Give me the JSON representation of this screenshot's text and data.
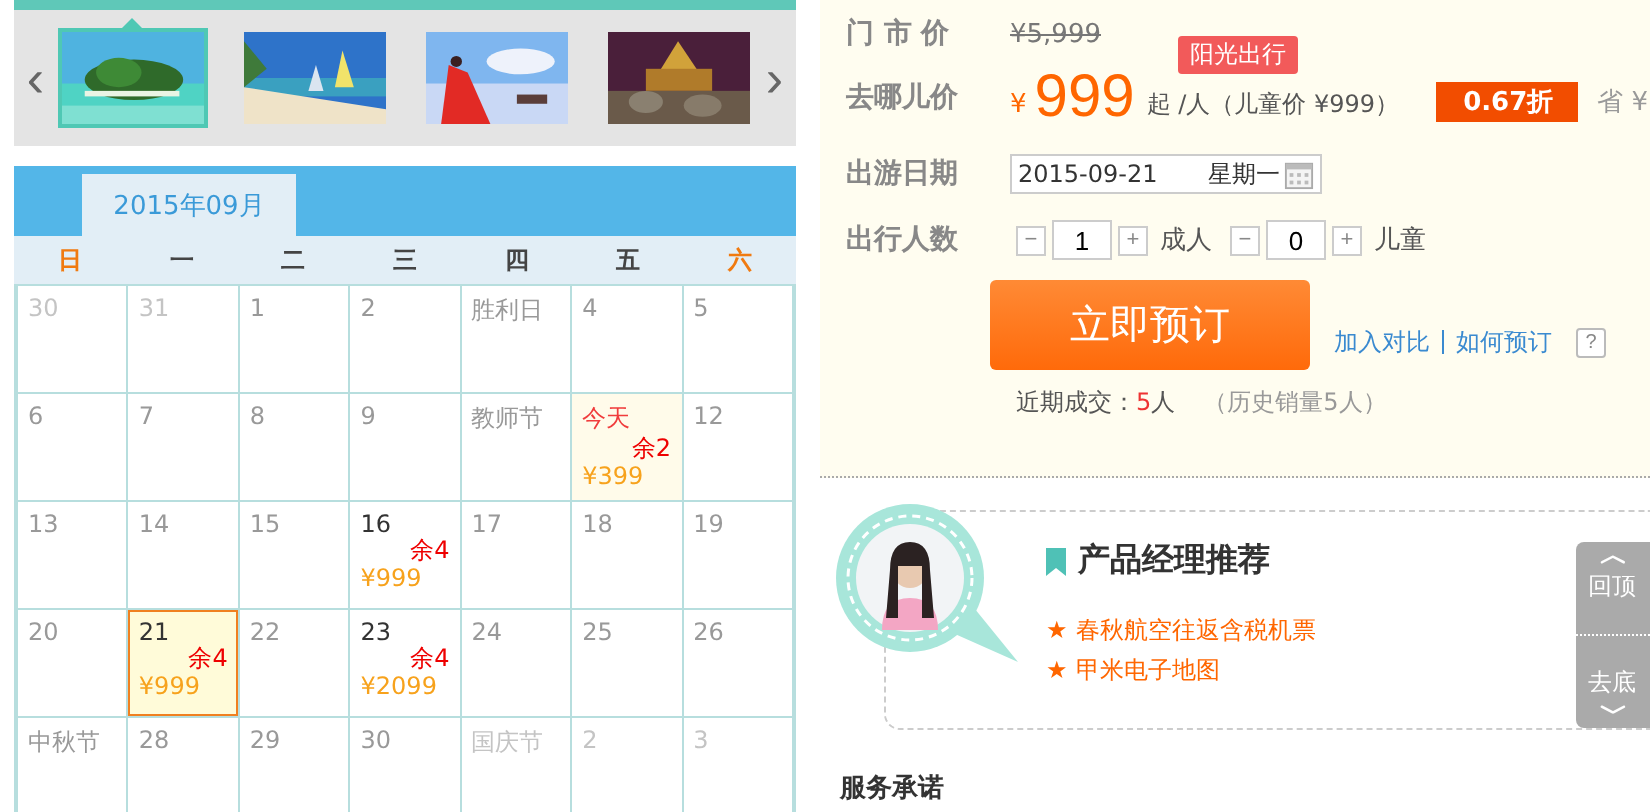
{
  "gallery": {
    "prev": "‹",
    "next": "›",
    "thumbnails": [
      {
        "kind": "picture",
        "selected": true
      },
      {
        "kind": "picture",
        "selected": false
      },
      {
        "kind": "picture",
        "selected": false
      },
      {
        "kind": "picture",
        "selected": false
      }
    ]
  },
  "calendar": {
    "month_tab": "2015年09月",
    "weekdays": [
      {
        "label": "日",
        "weekend": true
      },
      {
        "label": "一",
        "weekend": false
      },
      {
        "label": "二",
        "weekend": false
      },
      {
        "label": "三",
        "weekend": false
      },
      {
        "label": "四",
        "weekend": false
      },
      {
        "label": "五",
        "weekend": false
      },
      {
        "label": "六",
        "weekend": true
      }
    ],
    "weeks": [
      [
        {
          "label": "30",
          "kind": "other"
        },
        {
          "label": "31",
          "kind": "other"
        },
        {
          "label": "1",
          "kind": "day"
        },
        {
          "label": "2",
          "kind": "day"
        },
        {
          "label": "胜利日",
          "kind": "holiday"
        },
        {
          "label": "4",
          "kind": "day"
        },
        {
          "label": "5",
          "kind": "day"
        }
      ],
      [
        {
          "label": "6",
          "kind": "day"
        },
        {
          "label": "7",
          "kind": "day"
        },
        {
          "label": "8",
          "kind": "day"
        },
        {
          "label": "9",
          "kind": "day"
        },
        {
          "label": "教师节",
          "kind": "holiday"
        },
        {
          "label": "今天",
          "kind": "today",
          "remaining": "余2",
          "price": "¥399",
          "selected": false
        },
        {
          "label": "12",
          "kind": "day"
        }
      ],
      [
        {
          "label": "13",
          "kind": "day"
        },
        {
          "label": "14",
          "kind": "day"
        },
        {
          "label": "15",
          "kind": "day"
        },
        {
          "label": "16",
          "kind": "bookable",
          "remaining": "余4",
          "price": "¥999",
          "selected": false
        },
        {
          "label": "17",
          "kind": "day"
        },
        {
          "label": "18",
          "kind": "day"
        },
        {
          "label": "19",
          "kind": "day"
        }
      ],
      [
        {
          "label": "20",
          "kind": "day"
        },
        {
          "label": "21",
          "kind": "bookable",
          "remaining": "余4",
          "price": "¥999",
          "selected": true
        },
        {
          "label": "22",
          "kind": "day"
        },
        {
          "label": "23",
          "kind": "bookable",
          "remaining": "余4",
          "price": "¥2099",
          "selected": false
        },
        {
          "label": "24",
          "kind": "day"
        },
        {
          "label": "25",
          "kind": "day"
        },
        {
          "label": "26",
          "kind": "day"
        }
      ],
      [
        {
          "label": "中秋节",
          "kind": "holiday"
        },
        {
          "label": "28",
          "kind": "day"
        },
        {
          "label": "29",
          "kind": "day"
        },
        {
          "label": "30",
          "kind": "day"
        },
        {
          "label": "国庆节",
          "kind": "other"
        },
        {
          "label": "2",
          "kind": "other"
        },
        {
          "label": "3",
          "kind": "other"
        }
      ]
    ]
  },
  "booking": {
    "market_price_label": "门 市 价",
    "market_price": "¥5,999",
    "promo_tag": "阳光出行",
    "price_label": "去哪儿价",
    "currency": "¥",
    "price": "999",
    "price_suffix": "起 /人（儿童价 ¥999）",
    "discount": "0.67折",
    "save_label": "省 ¥",
    "date_label": "出游日期",
    "date_value": "2015-09-21",
    "weekday": "星期一",
    "travelers_label": "出行人数",
    "counters": [
      {
        "minus": "−",
        "value": "1",
        "plus": "+",
        "unit": "成人"
      },
      {
        "minus": "−",
        "value": "0",
        "plus": "+",
        "unit": "儿童"
      }
    ],
    "book_button": "立即预订",
    "compare_link": "加入对比",
    "how_link": "如何预订",
    "help": "?",
    "recent_label": "近期成交：",
    "recent_count": "5",
    "recent_unit": "人",
    "history": "（历史销量5人）"
  },
  "manager": {
    "title": "产品经理推荐",
    "recommendations": [
      "春秋航空往返含税机票",
      "甲米电子地图"
    ],
    "star": "★"
  },
  "side_tab": {
    "top_arrow": "︿",
    "top": "回顶",
    "bottom": "去底",
    "bottom_arrow": "﹀"
  },
  "services": {
    "title": "服务承诺"
  }
}
